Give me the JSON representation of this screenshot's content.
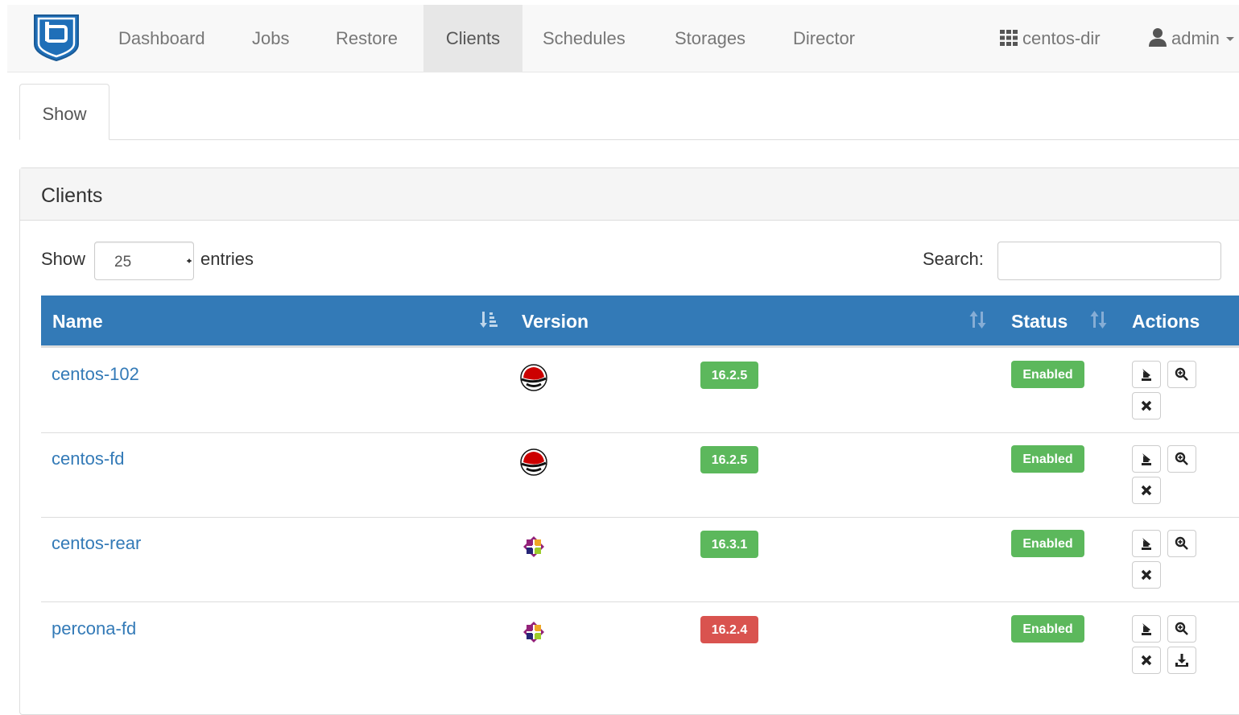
{
  "nav": {
    "items": [
      {
        "label": "Dashboard",
        "active": false
      },
      {
        "label": "Jobs",
        "active": false
      },
      {
        "label": "Restore",
        "active": false
      },
      {
        "label": "Clients",
        "active": true
      },
      {
        "label": "Schedules",
        "active": false
      },
      {
        "label": "Storages",
        "active": false
      },
      {
        "label": "Director",
        "active": false
      }
    ],
    "director_name": "centos-dir",
    "user_name": "admin",
    "brand_color": "#1f6fb8"
  },
  "tabs": {
    "show_label": "Show"
  },
  "panel": {
    "title": "Clients"
  },
  "table_controls": {
    "show_label": "Show",
    "page_length": "25",
    "entries_label": "entries",
    "search_label": "Search:",
    "search_value": ""
  },
  "table": {
    "header_color": "#337ab7",
    "columns": [
      "Name",
      "Version",
      "Status",
      "Actions"
    ],
    "rows": [
      {
        "name": "centos-102",
        "os_icon": "redhat-icon",
        "version": "16.2.5",
        "version_state": "ok",
        "status": "Enabled"
      },
      {
        "name": "centos-fd",
        "os_icon": "redhat-icon",
        "version": "16.2.5",
        "version_state": "ok",
        "status": "Enabled"
      },
      {
        "name": "centos-rear",
        "os_icon": "centos-icon",
        "version": "16.3.1",
        "version_state": "ok",
        "status": "Enabled"
      },
      {
        "name": "percona-fd",
        "os_icon": "centos-icon",
        "version": "16.2.4",
        "version_state": "outdated",
        "status": "Enabled"
      }
    ]
  },
  "colors": {
    "ok": "#5cb85c",
    "outdated": "#d9534f",
    "link": "#337ab7"
  }
}
